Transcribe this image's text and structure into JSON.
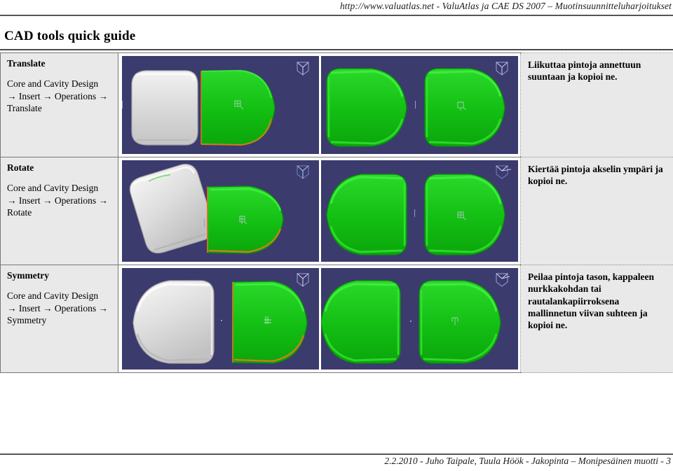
{
  "header": {
    "text": "http://www.valuatlas.net - ValuAtlas ja CAE DS 2007 – Muotinsuunnitteluharjoitukset"
  },
  "title": "CAD tools quick guide",
  "rows": [
    {
      "command": "Translate",
      "path_line1": "Core and Cavity Design",
      "path_line2": "→ Insert → Operations →",
      "path_line3": "Translate",
      "note": "Liikuttaa pintoja annettuun suuntaan ja kopioi ne.",
      "image_before_alt": "gray-part-and-green-part-side-by-side",
      "image_after_alt": "two-green-parts-side-by-side"
    },
    {
      "command": "Rotate",
      "path_line1": "Core and Cavity Design",
      "path_line2": "→ Insert → Operations →",
      "path_line3": "Rotate",
      "note": "Kiertää pintoja akselin ympäri ja kopioi ne.",
      "image_before_alt": "rotated-gray-part-and-green-part",
      "image_after_alt": "two-green-parts-rotated"
    },
    {
      "command": "Symmetry",
      "path_line1": "Core and Cavity Design",
      "path_line2": "→ Insert → Operations →",
      "path_line3": "Symmetry",
      "note": "Peilaa pintoja tason, kappaleen nurkkakohdan tai rautalankapiirroksena mallinnetun viivan suhteen ja kopioi ne.",
      "image_before_alt": "mirrored-gray-part-and-green-part",
      "image_after_alt": "two-mirrored-green-parts"
    }
  ],
  "footer": {
    "text": "2.2.2010 - Juho Taipale, Tuula Höök - Jakopinta – Monipesäinen muotti - 3"
  },
  "colors": {
    "viewport_background": "#3b3b6e",
    "part_green": "#1fc21f",
    "part_gray": "#d4d4d4",
    "edge_orange": "#e07b18",
    "page_cell_background": "#e9e9e9",
    "rule": "#555555"
  }
}
